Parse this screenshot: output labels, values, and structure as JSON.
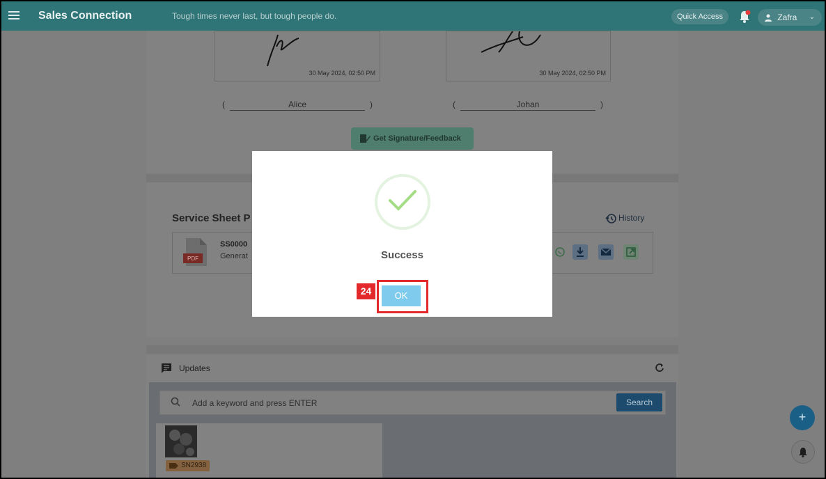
{
  "header": {
    "app_title": "Sales Connection",
    "tagline": "Tough times never last, but tough people do.",
    "quick_access": "Quick Access",
    "user_name": "Zafra"
  },
  "signatures": [
    {
      "timestamp": "30 May 2024, 02:50 PM",
      "name": "Alice"
    },
    {
      "timestamp": "30 May 2024, 02:50 PM",
      "name": "Johan"
    }
  ],
  "paren_open": "(",
  "paren_close": ")",
  "get_signature_label": "Get Signature/Feedback",
  "service_sheet": {
    "title_visible": "Service Sheet P",
    "history_label": "History",
    "file": {
      "code_visible": "SS0000",
      "status_visible": "Generat",
      "type_label": "PDF"
    }
  },
  "updates": {
    "title": "Updates",
    "search_placeholder": "Add a keyword and press ENTER",
    "search_button": "Search",
    "items": [
      {
        "tag": "SN2938"
      }
    ]
  },
  "modal": {
    "title": "Success",
    "ok_label": "OK",
    "step_badge": "24"
  },
  "fab": {
    "add_label": "+"
  },
  "colors": {
    "topbar": "#2f7476",
    "success_check": "#a5dc86",
    "ok_button": "#7fcbee",
    "highlight": "#e4292c"
  }
}
